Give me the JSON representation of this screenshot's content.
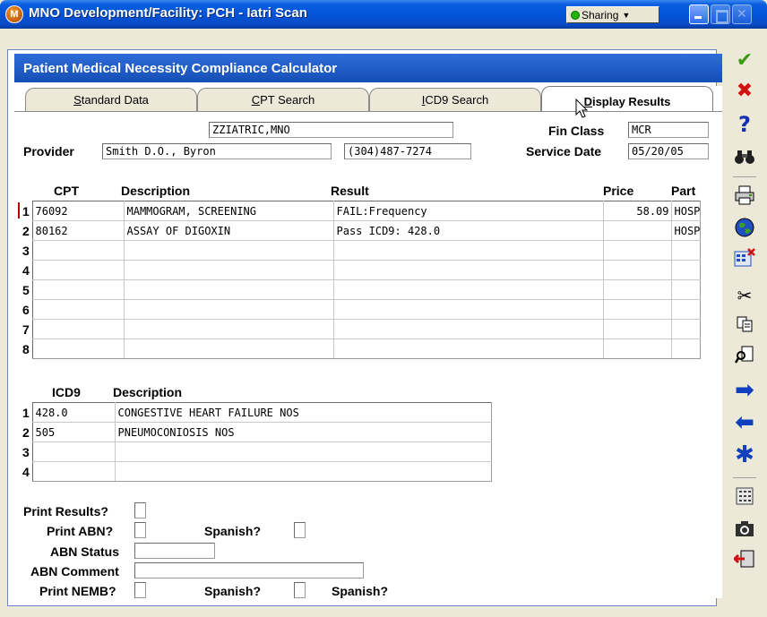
{
  "window": {
    "title": "MNO Development/Facility: PCH - Iatri Scan",
    "app_icon_letter": "M",
    "sharing_label": "Sharing"
  },
  "panel": {
    "title": "Patient Medical Necessity Compliance Calculator"
  },
  "tabs": [
    {
      "accel": "S",
      "rest": "tandard Data"
    },
    {
      "accel": "C",
      "rest": "PT Search"
    },
    {
      "accel": "I",
      "rest": "CD9 Search"
    },
    {
      "accel": "D",
      "rest": "isplay Results"
    }
  ],
  "patient": {
    "name": "ZZIATRIC,MNO",
    "provider_label": "Provider",
    "provider_name": "Smith D.O., Byron",
    "provider_phone": "(304)487-7274",
    "fin_class_label": "Fin Class",
    "fin_class": "MCR",
    "service_date_label": "Service Date",
    "service_date": "05/20/05"
  },
  "cpt_table": {
    "headers": {
      "cpt": "CPT",
      "description": "Description",
      "result": "Result",
      "price": "Price",
      "part": "Part"
    },
    "rows": [
      {
        "num": "1",
        "cpt": "76092",
        "description": "MAMMOGRAM, SCREENING",
        "result": "FAIL:Frequency",
        "price": "58.09",
        "part": "HOSP"
      },
      {
        "num": "2",
        "cpt": "80162",
        "description": "ASSAY OF DIGOXIN",
        "result": "Pass ICD9: 428.0",
        "price": "",
        "part": "HOSP"
      },
      {
        "num": "3",
        "cpt": "",
        "description": "",
        "result": "",
        "price": "",
        "part": ""
      },
      {
        "num": "4",
        "cpt": "",
        "description": "",
        "result": "",
        "price": "",
        "part": ""
      },
      {
        "num": "5",
        "cpt": "",
        "description": "",
        "result": "",
        "price": "",
        "part": ""
      },
      {
        "num": "6",
        "cpt": "",
        "description": "",
        "result": "",
        "price": "",
        "part": ""
      },
      {
        "num": "7",
        "cpt": "",
        "description": "",
        "result": "",
        "price": "",
        "part": ""
      },
      {
        "num": "8",
        "cpt": "",
        "description": "",
        "result": "",
        "price": "",
        "part": ""
      }
    ]
  },
  "icd9_table": {
    "headers": {
      "code": "ICD9",
      "description": "Description"
    },
    "rows": [
      {
        "num": "1",
        "code": "428.0",
        "description": "CONGESTIVE HEART FAILURE NOS"
      },
      {
        "num": "2",
        "code": "505",
        "description": "PNEUMOCONIOSIS NOS"
      },
      {
        "num": "3",
        "code": "",
        "description": ""
      },
      {
        "num": "4",
        "code": "",
        "description": ""
      }
    ]
  },
  "options": {
    "print_results_label": "Print Results?",
    "print_abn_label": "Print ABN?",
    "spanish_label": "Spanish?",
    "abn_status_label": "ABN Status",
    "abn_status": "",
    "abn_comment_label": "ABN Comment",
    "abn_comment": "",
    "print_nemb_label": "Print NEMB?",
    "spanish_label_2": "Spanish?",
    "spanish_label_3": "Spanish?"
  },
  "toolbar_icons": [
    "checkmark-icon",
    "cancel-icon",
    "help-icon",
    "binoculars-icon",
    "printer-icon",
    "globe-icon",
    "calculator-icon",
    "scissors-icon",
    "copy-icon",
    "find-icon",
    "arrow-right-icon",
    "arrow-left-icon",
    "asterisk-icon",
    "keypad-icon",
    "camera-icon",
    "exit-icon"
  ],
  "colors": {
    "title_bar": "#0352d6",
    "panel_header": "#1f5cc6",
    "accept": "#3a9a10",
    "cancel": "#d01010",
    "navigate": "#1040c0",
    "error_marker": "#c00000"
  }
}
